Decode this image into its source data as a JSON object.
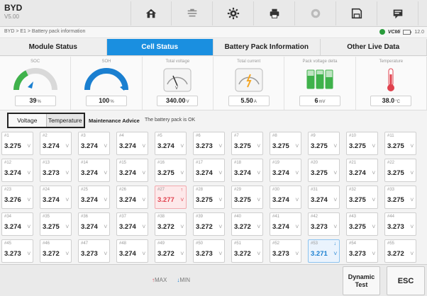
{
  "header": {
    "brand": "BYD",
    "version": "V5.00"
  },
  "toolbar": [
    {
      "icon": "home-icon"
    },
    {
      "icon": "car-lift-icon"
    },
    {
      "icon": "settings-icon"
    },
    {
      "icon": "printer-icon"
    },
    {
      "icon": "help-icon"
    },
    {
      "icon": "save-icon"
    },
    {
      "icon": "message-icon"
    }
  ],
  "breadcrumb": "BYD > E1 > Battery pack information",
  "status": {
    "vcm": "VCMi",
    "battery": "12.0"
  },
  "tabs": [
    {
      "label": "Module Status",
      "active": false
    },
    {
      "label": "Cell Status",
      "active": true
    },
    {
      "label": "Battery Pack Information",
      "active": false
    },
    {
      "label": "Other Live Data",
      "active": false
    }
  ],
  "gauges": [
    {
      "label": "SOC",
      "value": "39",
      "unit": "%",
      "icon": "soc-gauge-icon"
    },
    {
      "label": "SOH",
      "value": "100",
      "unit": "%",
      "icon": "soh-gauge-icon"
    },
    {
      "label": "Total voltage",
      "value": "340.00",
      "unit": "V",
      "icon": "voltmeter-icon"
    },
    {
      "label": "Total current",
      "value": "5.50",
      "unit": "A",
      "icon": "ammeter-icon"
    },
    {
      "label": "Pack voltage delta",
      "value": "6",
      "unit": "mV",
      "icon": "battery-cells-icon"
    },
    {
      "label": "Temperature",
      "value": "38.0",
      "unit": "°C",
      "icon": "thermometer-icon"
    }
  ],
  "subtabs": [
    {
      "label": "Voltage",
      "selected": true
    },
    {
      "label": "Temperature",
      "selected": false
    }
  ],
  "advice": {
    "title": "Maintenance Advice",
    "text": "The battery pack is OK"
  },
  "unit": "V",
  "max_arrow": "↑",
  "min_arrow": "↓",
  "cells": [
    {
      "id": "#1",
      "v": "3.275"
    },
    {
      "id": "#2",
      "v": "3.274"
    },
    {
      "id": "#3",
      "v": "3.274"
    },
    {
      "id": "#4",
      "v": "3.274"
    },
    {
      "id": "#5",
      "v": "3.274"
    },
    {
      "id": "#6",
      "v": "3.273"
    },
    {
      "id": "#7",
      "v": "3.275"
    },
    {
      "id": "#8",
      "v": "3.275"
    },
    {
      "id": "#9",
      "v": "3.275"
    },
    {
      "id": "#10",
      "v": "3.275"
    },
    {
      "id": "#11",
      "v": "3.275"
    },
    {
      "id": "#12",
      "v": "3.274"
    },
    {
      "id": "#13",
      "v": "3.273"
    },
    {
      "id": "#14",
      "v": "3.274"
    },
    {
      "id": "#15",
      "v": "3.274"
    },
    {
      "id": "#16",
      "v": "3.275"
    },
    {
      "id": "#17",
      "v": "3.274"
    },
    {
      "id": "#18",
      "v": "3.274"
    },
    {
      "id": "#19",
      "v": "3.274"
    },
    {
      "id": "#20",
      "v": "3.275"
    },
    {
      "id": "#21",
      "v": "3.274"
    },
    {
      "id": "#22",
      "v": "3.275"
    },
    {
      "id": "#23",
      "v": "3.276"
    },
    {
      "id": "#24",
      "v": "3.274"
    },
    {
      "id": "#25",
      "v": "3.274"
    },
    {
      "id": "#26",
      "v": "3.274"
    },
    {
      "id": "#27",
      "v": "3.277",
      "flag": "max"
    },
    {
      "id": "#28",
      "v": "3.275"
    },
    {
      "id": "#29",
      "v": "3.275"
    },
    {
      "id": "#30",
      "v": "3.274"
    },
    {
      "id": "#31",
      "v": "3.274"
    },
    {
      "id": "#32",
      "v": "3.275"
    },
    {
      "id": "#33",
      "v": "3.275"
    },
    {
      "id": "#34",
      "v": "3.274"
    },
    {
      "id": "#35",
      "v": "3.275"
    },
    {
      "id": "#36",
      "v": "3.274"
    },
    {
      "id": "#37",
      "v": "3.274"
    },
    {
      "id": "#38",
      "v": "3.272"
    },
    {
      "id": "#39",
      "v": "3.272"
    },
    {
      "id": "#40",
      "v": "3.272"
    },
    {
      "id": "#41",
      "v": "3.274"
    },
    {
      "id": "#42",
      "v": "3.273"
    },
    {
      "id": "#43",
      "v": "3.275"
    },
    {
      "id": "#44",
      "v": "3.273"
    },
    {
      "id": "#45",
      "v": "3.273"
    },
    {
      "id": "#46",
      "v": "3.272"
    },
    {
      "id": "#47",
      "v": "3.273"
    },
    {
      "id": "#48",
      "v": "3.274"
    },
    {
      "id": "#49",
      "v": "3.272"
    },
    {
      "id": "#50",
      "v": "3.273"
    },
    {
      "id": "#51",
      "v": "3.272"
    },
    {
      "id": "#52",
      "v": "3.273"
    },
    {
      "id": "#53",
      "v": "3.271",
      "flag": "min"
    },
    {
      "id": "#54",
      "v": "3.273"
    },
    {
      "id": "#55",
      "v": "3.272"
    }
  ],
  "legend": {
    "max": "MAX",
    "min": "MIN"
  },
  "buttons": {
    "dynamic_test": "Dynamic Test",
    "esc": "ESC"
  }
}
